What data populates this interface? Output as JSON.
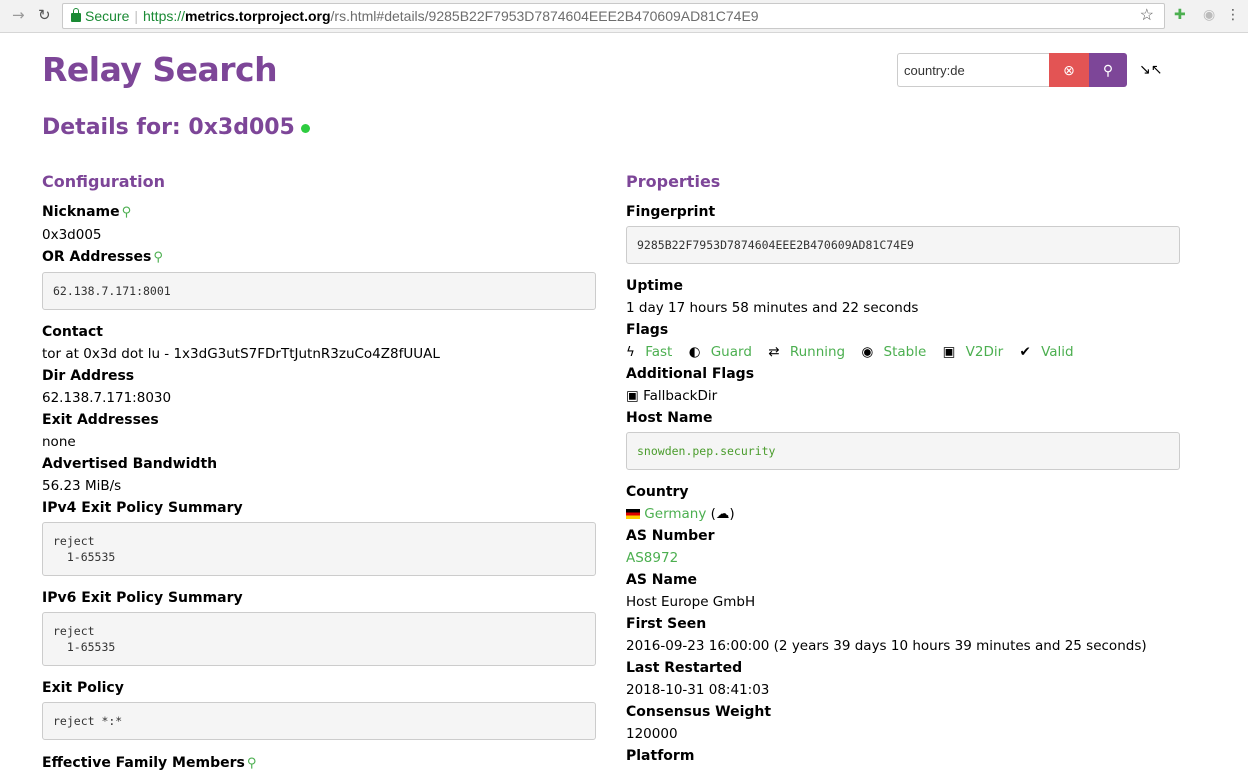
{
  "browser": {
    "secure_label": "Secure",
    "url_scheme": "https://",
    "url_host": "metrics.torproject.org",
    "url_path": "/rs.html#details/9285B22F7953D7874604EEE2B470609AD81C74E9"
  },
  "header": {
    "title": "Relay Search",
    "search_value": "country:de",
    "details_prefix": "Details for:",
    "nickname": "0x3d005",
    "status_color": "#2ecc40"
  },
  "config": {
    "heading": "Configuration",
    "nickname_label": "Nickname",
    "nickname": "0x3d005",
    "or_label": "OR Addresses",
    "or_value": "62.138.7.171:8001",
    "contact_label": "Contact",
    "contact": "tor at 0x3d dot lu - 1x3dG3utS7FDrTtJutnR3zuCo4Z8fUUAL",
    "dir_label": "Dir Address",
    "dir": "62.138.7.171:8030",
    "exit_label": "Exit Addresses",
    "exit": "none",
    "bw_label": "Advertised Bandwidth",
    "bw": "56.23 MiB/s",
    "ipv4_label": "IPv4 Exit Policy Summary",
    "ipv4": "reject\n  1-65535",
    "ipv6_label": "IPv6 Exit Policy Summary",
    "ipv6": "reject\n  1-65535",
    "policy_label": "Exit Policy",
    "policy": "reject *:*",
    "family_label": "Effective Family Members"
  },
  "props": {
    "heading": "Properties",
    "fp_label": "Fingerprint",
    "fp": "9285B22F7953D7874604EEE2B470609AD81C74E9",
    "uptime_label": "Uptime",
    "uptime": "1 day 17 hours 58 minutes and 22 seconds",
    "flags_label": "Flags",
    "flags": [
      "Fast",
      "Guard",
      "Running",
      "Stable",
      "V2Dir",
      "Valid"
    ],
    "add_flags_label": "Additional Flags",
    "add_flag": "FallbackDir",
    "host_label": "Host Name",
    "host": "snowden.pep.security",
    "country_label": "Country",
    "country": "Germany",
    "as_num_label": "AS Number",
    "as_num": "AS8972",
    "as_name_label": "AS Name",
    "as_name": "Host Europe GmbH",
    "first_label": "First Seen",
    "first": "2016-09-23 16:00:00 (2 years 39 days 10 hours 39 minutes and 25 seconds)",
    "restart_label": "Last Restarted",
    "restart": "2018-10-31 08:41:03",
    "weight_label": "Consensus Weight",
    "weight": "120000",
    "platform_label": "Platform"
  },
  "colors": {
    "accent": "#7d4698",
    "link": "#4caf50",
    "danger": "#e35454"
  }
}
